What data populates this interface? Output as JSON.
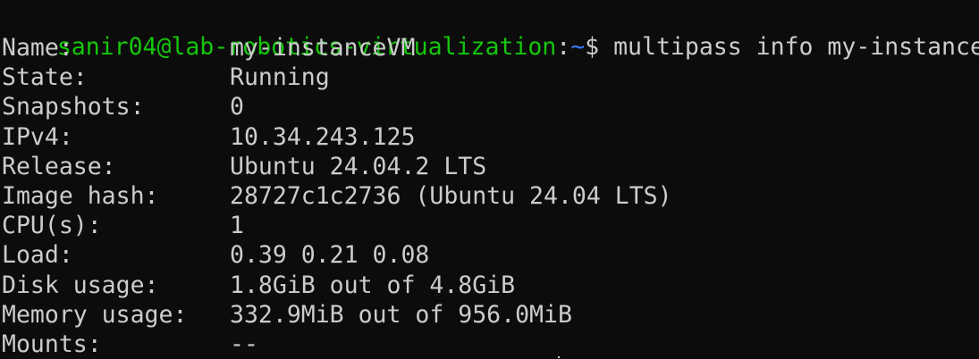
{
  "prompt": {
    "user_host": "sanir04@lab-robotics-virtualization",
    "separator": ":",
    "path": "~",
    "dollar": "$ ",
    "command": "multipass info my-instanceVM"
  },
  "info": [
    {
      "key": "Name:",
      "value": "my-instanceVM"
    },
    {
      "key": "State:",
      "value": "Running"
    },
    {
      "key": "Snapshots:",
      "value": "0"
    },
    {
      "key": "IPv4:",
      "value": "10.34.243.125"
    },
    {
      "key": "Release:",
      "value": "Ubuntu 24.04.2 LTS"
    },
    {
      "key": "Image hash:",
      "value": "28727c1c2736 (Ubuntu 24.04 LTS)"
    },
    {
      "key": "CPU(s):",
      "value": "1"
    },
    {
      "key": "Load:",
      "value": "0.39 0.21 0.08"
    },
    {
      "key": "Disk usage:",
      "value": "1.8GiB out of 4.8GiB"
    },
    {
      "key": "Memory usage:",
      "value": "332.9MiB out of 956.0MiB"
    },
    {
      "key": "Mounts:",
      "value": "--"
    }
  ],
  "colors": {
    "background": "#0c0c0c",
    "foreground": "#cccccc",
    "prompt_user": "#16c60c",
    "prompt_path": "#3b78ff"
  }
}
